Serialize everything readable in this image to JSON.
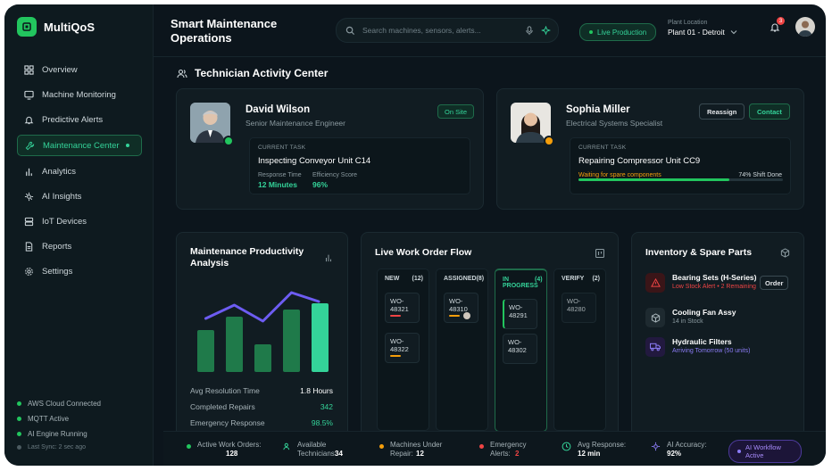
{
  "app": {
    "name": "MultiQoS"
  },
  "sidebar": {
    "items": [
      {
        "label": "Overview",
        "icon": "grid-icon"
      },
      {
        "label": "Machine Monitoring",
        "icon": "monitor-icon"
      },
      {
        "label": "Predictive Alerts",
        "icon": "bell-icon"
      },
      {
        "label": "Maintenance Center",
        "icon": "wrench-icon",
        "active": true
      },
      {
        "label": "Analytics",
        "icon": "bar-chart-icon"
      },
      {
        "label": "AI Insights",
        "icon": "ai-icon"
      },
      {
        "label": "IoT Devices",
        "icon": "server-icon"
      },
      {
        "label": "Reports",
        "icon": "document-icon"
      },
      {
        "label": "Settings",
        "icon": "gear-icon"
      }
    ],
    "status": [
      "AWS Cloud Connected",
      "MQTT Active",
      "AI Engine Running"
    ],
    "sync": "Last Sync: 2 sec ago"
  },
  "header": {
    "title": "Smart Maintenance Operations",
    "search_placeholder": "Search machines, sensors, alerts...",
    "live": "Live Production",
    "plant_label": "Plant Location",
    "plant_value": "Plant 01 - Detroit",
    "notification_count": "3"
  },
  "section": {
    "title": "Technician Activity Center"
  },
  "technicians": [
    {
      "name": "David Wilson",
      "role": "Senior Maintenance Engineer",
      "status": "On Site",
      "task_label": "CURRENT TASK",
      "task": "Inspecting Conveyor Unit C14",
      "metric1_label": "Response Time",
      "metric1_value": "12 Minutes",
      "metric2_label": "Efficiency Score",
      "metric2_value": "96%"
    },
    {
      "name": "Sophia Miller",
      "role": "Electrical Systems Specialist",
      "reassign": "Reassign",
      "contact": "Contact",
      "task_label": "CURRENT TASK",
      "task": "Repairing Compressor Unit CC9",
      "note": "Waiting for spare components",
      "shift": "74% Shift Done",
      "shift_progress": 0.74
    }
  ],
  "productivity": {
    "title": "Maintenance Productivity Analysis",
    "rows": [
      {
        "label": "Avg Resolution Time",
        "value": "1.8 Hours"
      },
      {
        "label": "Completed Repairs",
        "value": "342"
      },
      {
        "label": "Emergency Response",
        "value": "98.5%"
      }
    ]
  },
  "chart_data": {
    "type": "bar",
    "title": "",
    "categories": [
      "1",
      "2",
      "3",
      "4",
      "5",
      "6"
    ],
    "values": [
      47,
      62,
      31,
      70,
      77,
      55
    ],
    "series": [
      {
        "values": [
          47,
          62,
          31,
          70,
          77,
          55
        ]
      }
    ],
    "line": [
      56,
      71,
      53,
      85,
      75,
      96
    ],
    "ylim": [
      0,
      100
    ],
    "grid": false,
    "colors": {
      "bar": "#1f7a4a",
      "bar_highlight": "#34d399",
      "line": "#6d5cf2"
    }
  },
  "workflow": {
    "title": "Live Work Order Flow",
    "columns": [
      {
        "name": "NEW",
        "count": "(12)",
        "orders": [
          {
            "id": "WO-48321",
            "color": "#ef4444"
          },
          {
            "id": "WO-48322",
            "color": "#f59e0b"
          }
        ]
      },
      {
        "name": "ASSIGNED",
        "count": "(8)",
        "orders": [
          {
            "id": "WO-48310",
            "color": "#f59e0b"
          }
        ]
      },
      {
        "name": "IN PROGRESS",
        "count": "(4)",
        "orders": [
          {
            "id": "WO-48291",
            "color": "#22c55e"
          },
          {
            "id": "WO-48302",
            "color": ""
          }
        ]
      },
      {
        "name": "VERIFY",
        "count": "(2)",
        "orders": [
          {
            "id": "WO-48280",
            "color": ""
          }
        ]
      }
    ]
  },
  "inventory": {
    "title": "Inventory & Spare Parts",
    "items": [
      {
        "name": "Bearing Sets (H-Series)",
        "sub": "Low Stock Alert • 2 Remaining",
        "action": "Order",
        "icon": "warning-icon",
        "color": "#ef4444"
      },
      {
        "name": "Cooling Fan Assy",
        "sub": "14 in Stock",
        "icon": "box-icon",
        "color": "#8a999f"
      },
      {
        "name": "Hydraulic Filters",
        "sub": "Arriving Tomorrow (50 units)",
        "icon": "truck-icon",
        "color": "#8b7cf6"
      }
    ]
  },
  "stats": [
    {
      "label": "Active Work Orders:",
      "value": "128"
    },
    {
      "label": "Available Technicians:",
      "value": "34"
    },
    {
      "label": "Machines Under Repair:",
      "value": "12"
    },
    {
      "label": "Emergency Alerts:",
      "value": "2"
    },
    {
      "label": "Avg Response:",
      "value": "12 min"
    },
    {
      "label": "AI Accuracy:",
      "value": "92%"
    }
  ],
  "ai_workflow": "AI Workflow Active"
}
